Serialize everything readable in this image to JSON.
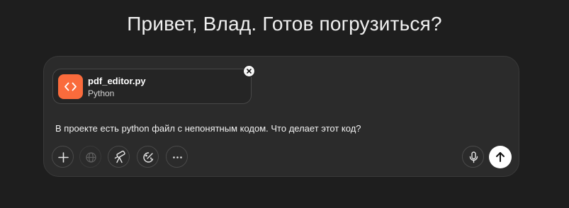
{
  "greeting": "Привет, Влад. Готов погрузиться?",
  "attachment": {
    "file_name": "pdf_editor.py",
    "file_type": "Python",
    "icon": "code-icon",
    "icon_color": "#fa6b3c"
  },
  "prompt": {
    "text": "В проекте есть python файл с непонятным кодом. Что делает этот код?"
  },
  "toolbar": {
    "buttons": [
      {
        "name": "add-button",
        "icon": "plus-icon"
      },
      {
        "name": "web-search-button",
        "icon": "globe-icon",
        "state": "disabled"
      },
      {
        "name": "deep-research-button",
        "icon": "telescope-icon"
      },
      {
        "name": "draw-image-button",
        "icon": "palette-icon"
      },
      {
        "name": "more-tools-button",
        "icon": "more-icon"
      }
    ],
    "voice_button_icon": "microphone-icon",
    "send_button_icon": "arrow-up-icon"
  }
}
